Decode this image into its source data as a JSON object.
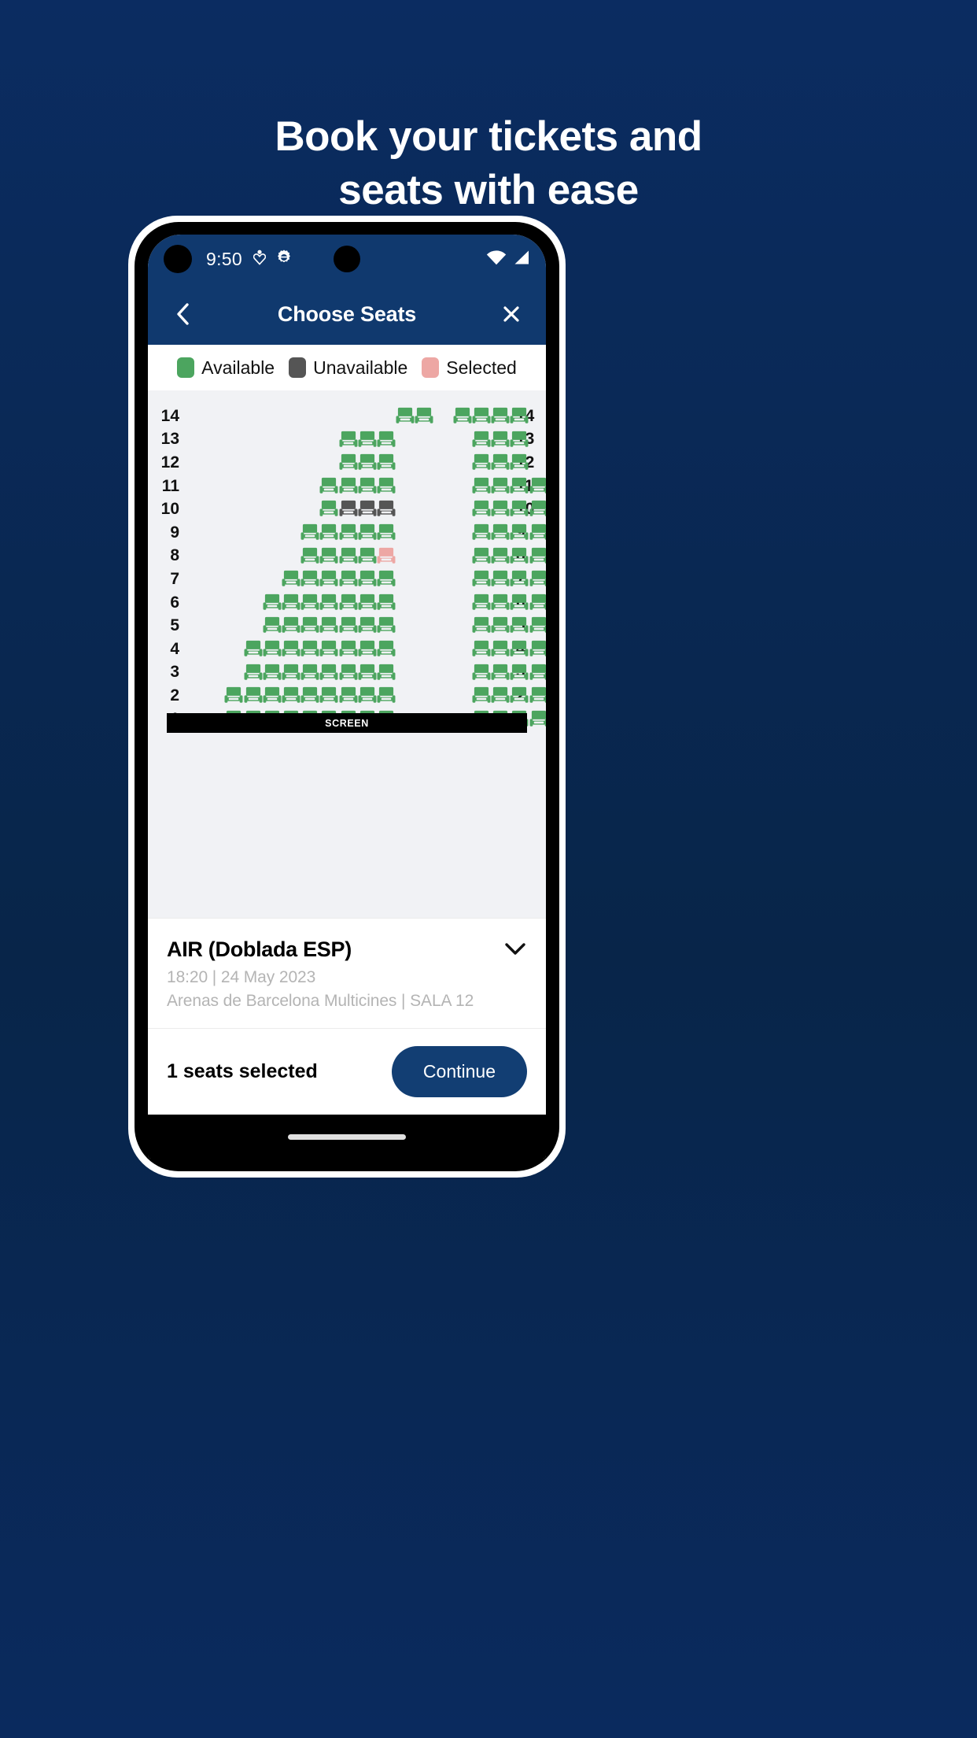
{
  "headline": {
    "line1": "Book your tickets and",
    "line2": "seats with ease"
  },
  "statusbar": {
    "clock": "9:50",
    "icons": [
      "heart-pulse-icon",
      "gear-icon",
      "wifi-icon",
      "signal-icon"
    ]
  },
  "appbar": {
    "back_label": "‹",
    "title": "Choose Seats",
    "close_label": "✕"
  },
  "legend": {
    "items": [
      {
        "label": "Available",
        "color": "#4CA55F"
      },
      {
        "label": "Unavailable",
        "color": "#555555"
      },
      {
        "label": "Selected",
        "color": "#EDA7A4"
      }
    ]
  },
  "seatmap": {
    "screen_label": "SCREEN",
    "row_labels": [
      "14",
      "13",
      "12",
      "11",
      "10",
      "9",
      "8",
      "7",
      "6",
      "5",
      "4",
      "3",
      "2",
      "1"
    ],
    "colors": {
      "available": "#4CA55F",
      "unavailable": "#555555",
      "selected": "#EDA7A4",
      "background": "#f1f2f5"
    },
    "rows": [
      {
        "label": "14",
        "left": {
          "start": 11,
          "seats": [
            "a",
            "a"
          ]
        },
        "right": {
          "start": 14,
          "seats": [
            "a",
            "a",
            "a",
            "a"
          ]
        }
      },
      {
        "label": "13",
        "left": {
          "start": 8,
          "seats": [
            "a",
            "a",
            "a"
          ]
        },
        "right": {
          "start": 15,
          "seats": [
            "a",
            "a",
            "a"
          ]
        }
      },
      {
        "label": "12",
        "left": {
          "start": 8,
          "seats": [
            "a",
            "a",
            "a"
          ]
        },
        "right": {
          "start": 15,
          "seats": [
            "a",
            "a",
            "a"
          ]
        }
      },
      {
        "label": "11",
        "left": {
          "start": 7,
          "seats": [
            "a",
            "a",
            "a",
            "a"
          ]
        },
        "right": {
          "start": 15,
          "seats": [
            "a",
            "a",
            "a",
            "a"
          ]
        }
      },
      {
        "label": "10",
        "left": {
          "start": 7,
          "seats": [
            "a",
            "u",
            "u",
            "u"
          ]
        },
        "right": {
          "start": 15,
          "seats": [
            "a",
            "a",
            "a",
            "a"
          ]
        }
      },
      {
        "label": "9",
        "left": {
          "start": 6,
          "seats": [
            "a",
            "a",
            "a",
            "a",
            "a"
          ]
        },
        "right": {
          "start": 15,
          "seats": [
            "a",
            "a",
            "a",
            "a",
            "a"
          ]
        }
      },
      {
        "label": "8",
        "left": {
          "start": 6,
          "seats": [
            "a",
            "a",
            "a",
            "a",
            "s"
          ]
        },
        "right": {
          "start": 15,
          "seats": [
            "a",
            "a",
            "a",
            "a",
            "a",
            "a"
          ]
        }
      },
      {
        "label": "7",
        "left": {
          "start": 5,
          "seats": [
            "a",
            "a",
            "a",
            "a",
            "a",
            "a"
          ]
        },
        "right": {
          "start": 15,
          "seats": [
            "a",
            "a",
            "a",
            "a",
            "a",
            "a"
          ]
        }
      },
      {
        "label": "6",
        "left": {
          "start": 4,
          "seats": [
            "a",
            "a",
            "a",
            "a",
            "a",
            "a",
            "a"
          ]
        },
        "right": {
          "start": 15,
          "seats": [
            "a",
            "a",
            "a",
            "a"
          ]
        }
      },
      {
        "label": "5",
        "left": {
          "start": 4,
          "seats": [
            "a",
            "a",
            "a",
            "a",
            "a",
            "a",
            "a"
          ]
        },
        "right": {
          "start": 15,
          "seats": [
            "a",
            "a",
            "a",
            "a"
          ]
        }
      },
      {
        "label": "4",
        "left": {
          "start": 3,
          "seats": [
            "a",
            "a",
            "a",
            "a",
            "a",
            "a",
            "a",
            "a"
          ]
        },
        "right": {
          "start": 15,
          "seats": [
            "a",
            "a",
            "a",
            "a",
            "a"
          ]
        }
      },
      {
        "label": "3",
        "left": {
          "start": 3,
          "seats": [
            "a",
            "a",
            "a",
            "a",
            "a",
            "a",
            "a",
            "a"
          ]
        },
        "right": {
          "start": 15,
          "seats": [
            "a",
            "a",
            "a",
            "a",
            "a"
          ]
        }
      },
      {
        "label": "2",
        "left": {
          "start": 2,
          "seats": [
            "a",
            "a",
            "a",
            "a",
            "a",
            "a",
            "a",
            "a",
            "a"
          ]
        },
        "right": {
          "start": 15,
          "seats": [
            "a",
            "a",
            "a",
            "a",
            "a",
            "a"
          ]
        }
      },
      {
        "label": "1",
        "left": {
          "start": 2,
          "seats": [
            "a",
            "a",
            "a",
            "a",
            "a",
            "a",
            "a",
            "a",
            "a"
          ]
        },
        "right": {
          "start": 15,
          "seats": [
            "a",
            "a",
            "a",
            "a",
            "a",
            "w",
            "w"
          ]
        }
      }
    ]
  },
  "movie": {
    "title": "AIR (Doblada ESP)",
    "showtime": "18:20 | 24 May 2023",
    "venue": "Arenas de Barcelona Multicines | SALA 12",
    "expand_icon": "chevron-down-icon"
  },
  "footer": {
    "seats_selected": "1 seats selected",
    "continue_label": "Continue"
  }
}
